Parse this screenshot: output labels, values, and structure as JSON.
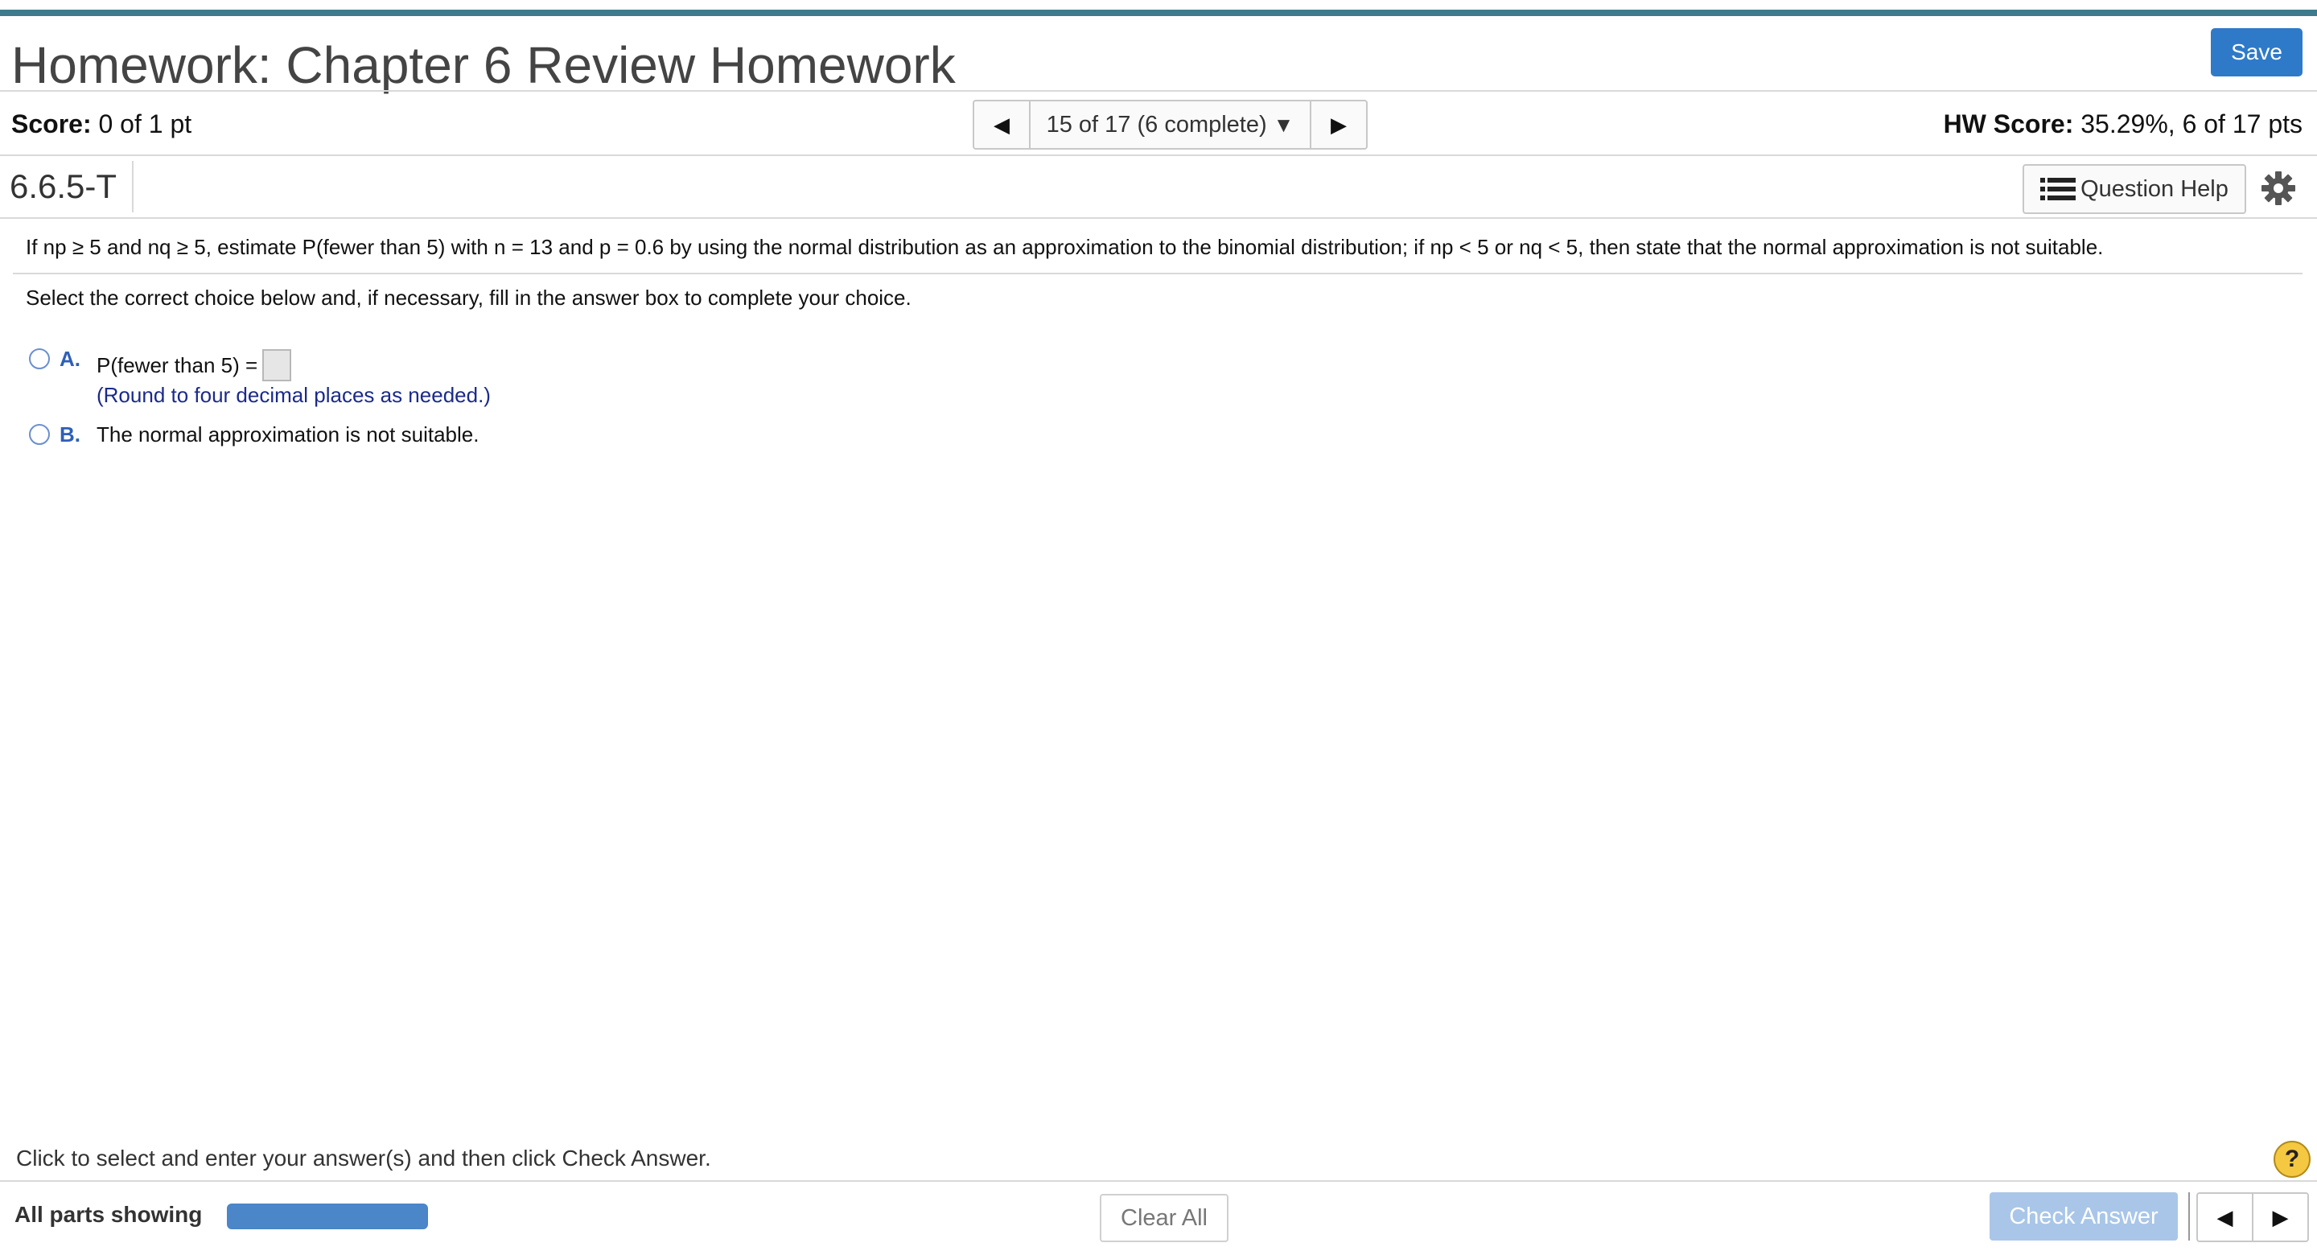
{
  "header": {
    "title": "Homework: Chapter 6 Review Homework",
    "save_label": "Save"
  },
  "scorebar": {
    "score_label": "Score:",
    "score_value": "0 of 1 pt",
    "nav_text": "15 of 17 (6 complete)",
    "hw_score_label": "HW Score:",
    "hw_score_value": "35.29%, 6 of 17 pts"
  },
  "question_bar": {
    "id": "6.6.5-T",
    "help_label": "Question Help"
  },
  "question": {
    "text": "If np ≥ 5 and nq ≥ 5, estimate P(fewer than 5) with n = 13 and p = 0.6 by using the normal distribution as an approximation to the binomial distribution; if np < 5 or nq < 5, then state that the normal approximation is not suitable.",
    "instruction": "Select the correct choice below and, if necessary, fill in the answer box to complete your choice.",
    "options": [
      {
        "letter": "A.",
        "text": "P(fewer than 5) =",
        "note": "(Round to four decimal places as needed.)"
      },
      {
        "letter": "B.",
        "text": "The normal approximation is not suitable."
      }
    ]
  },
  "footer": {
    "message": "Click to select and enter your answer(s) and then click Check Answer.",
    "help_glyph": "?",
    "parts_label": "All parts showing",
    "clear_label": "Clear All",
    "check_label": "Check Answer"
  },
  "colors": {
    "accent": "#2f7ac8",
    "topbar": "#3d7a8e",
    "progress": "#4a86c8"
  }
}
